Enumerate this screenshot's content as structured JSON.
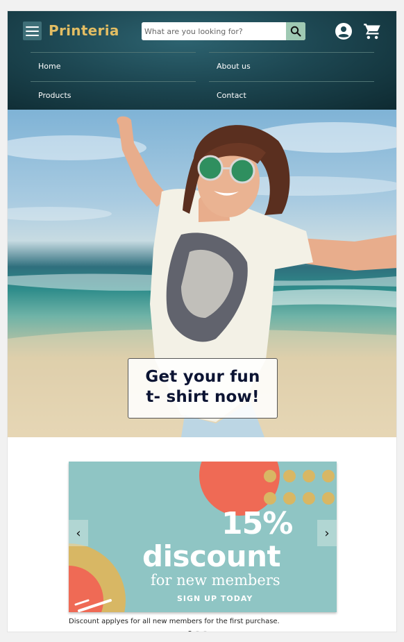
{
  "header": {
    "logo": "Printeria",
    "search_placeholder": "What are you looking for?",
    "icons": {
      "menu": "hamburger-menu-icon",
      "search": "search-icon",
      "account": "account-circle-icon",
      "cart": "shopping-cart-icon"
    },
    "colors": {
      "header_bg": "#1d4752",
      "logo": "#e2bd63",
      "search_button": "#9fc9b3"
    }
  },
  "nav": {
    "items": [
      {
        "label": "Home"
      },
      {
        "label": "About us"
      },
      {
        "label": "Products"
      },
      {
        "label": "Contact"
      }
    ]
  },
  "hero": {
    "cta_line1": "Get your fun",
    "cta_line2": "t- shirt now!",
    "cta_color": "#0c1433"
  },
  "promo": {
    "percent": "15%",
    "headline": "discount",
    "subline": "for new members",
    "action": "SIGN UP TODAY",
    "caption": "Discount applyes for all new members for the first purchase.",
    "prev_arrow": "‹",
    "next_arrow": "›",
    "colors": {
      "background": "#8fc5c4",
      "circle": "#ef6a55",
      "dots": "#d8b764"
    }
  },
  "carousel": {
    "slide_count": 3,
    "active_index": 0
  }
}
